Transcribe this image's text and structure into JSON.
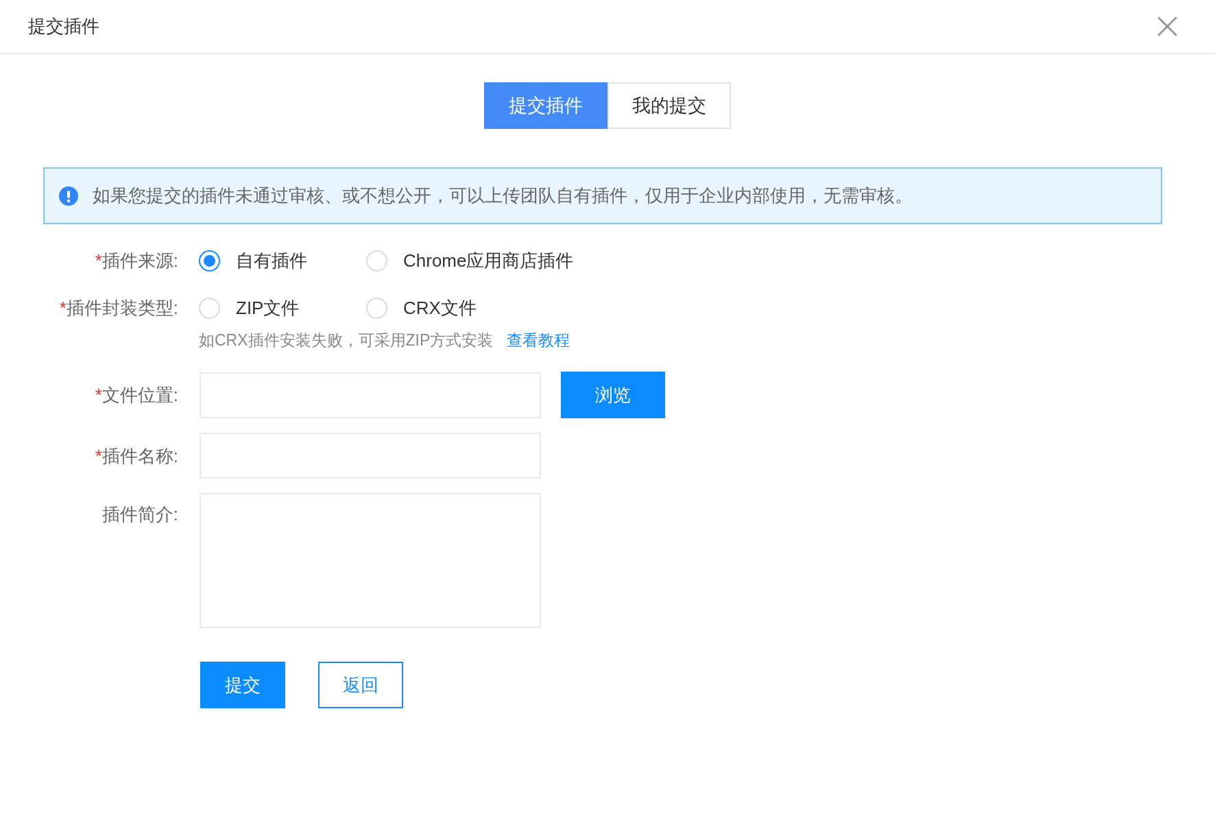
{
  "dialog": {
    "title": "提交插件"
  },
  "tabs": [
    {
      "label": "提交插件",
      "selected": true
    },
    {
      "label": "我的提交",
      "selected": false
    }
  ],
  "notice": {
    "text": "如果您提交的插件未通过审核、或不想公开，可以上传团队自有插件，仅用于企业内部使用，无需审核。"
  },
  "form": {
    "fields": [
      {
        "kind": "radio",
        "marker": "*",
        "label": "插件来源:",
        "options": [
          {
            "label": "自有插件",
            "selected": true
          },
          {
            "label": "Chrome应用商店插件",
            "selected": false
          }
        ]
      },
      {
        "kind": "radio",
        "marker": "*",
        "label": "插件封装类型:",
        "options": [
          {
            "label": "ZIP文件",
            "selected": false
          },
          {
            "label": "CRX文件",
            "selected": false
          }
        ],
        "hint": {
          "text": "如CRX插件安装失败，可采用ZIP方式安装",
          "link": "查看教程"
        }
      },
      {
        "kind": "file",
        "marker": "*",
        "label": "文件位置:",
        "button": "浏览"
      },
      {
        "kind": "text",
        "marker": "*",
        "label": "插件名称:"
      },
      {
        "kind": "textarea",
        "label": "插件简介:"
      }
    ],
    "buttons": [
      {
        "kind": "primary",
        "label": "提交"
      },
      {
        "kind": "outline",
        "label": "返回"
      }
    ]
  }
}
